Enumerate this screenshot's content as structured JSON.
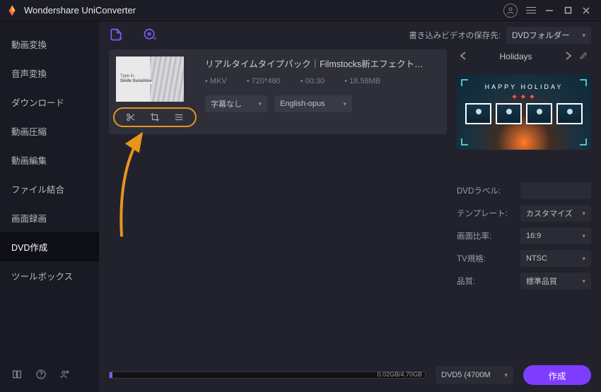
{
  "titlebar": {
    "app_name": "Wondershare UniConverter"
  },
  "sidebar": {
    "items": [
      {
        "label": "動画変換"
      },
      {
        "label": "音声変換"
      },
      {
        "label": "ダウンロード"
      },
      {
        "label": "動画圧縮"
      },
      {
        "label": "動画編集"
      },
      {
        "label": "ファイル結合"
      },
      {
        "label": "画面録画"
      },
      {
        "label": "DVD作成"
      },
      {
        "label": "ツールボックス"
      }
    ],
    "active_index": 7
  },
  "toolbar": {
    "dest_label": "書き込みビデオの保存先:",
    "dest_value": "DVDフォルダー"
  },
  "file": {
    "title": "リアルタイムタイプパック｜Filmstocks新エフェクト…",
    "thumb_line1": "Type in,",
    "thumb_line2": "Smile Sunshine",
    "format": "MKV",
    "resolution": "720*480",
    "duration": "00:30",
    "size": "18.58MB",
    "subtitle_value": "字幕なし",
    "audio_value": "English-opus"
  },
  "template": {
    "name": "Holidays",
    "banner": "HAPPY HOLIDAY"
  },
  "settings": {
    "label_label": "DVDラベル:",
    "label_value": "",
    "template_label": "テンプレート:",
    "template_value": "カスタマイズ",
    "aspect_label": "画面比率:",
    "aspect_value": "16:9",
    "tv_label": "TV規格:",
    "tv_value": "NTSC",
    "quality_label": "品質:",
    "quality_value": "標準品質"
  },
  "bottom": {
    "progress_text": "0.02GB/4.70GB",
    "disc_value": "DVD5 (4700M",
    "create_label": "作成"
  }
}
